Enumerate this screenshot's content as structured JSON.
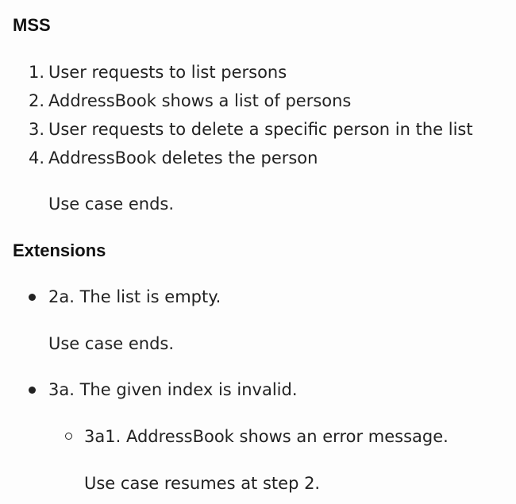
{
  "mss": {
    "heading": "MSS",
    "steps": [
      {
        "marker": "1.",
        "text": "User requests to list persons"
      },
      {
        "marker": "2.",
        "text": "AddressBook shows a list of persons"
      },
      {
        "marker": "3.",
        "text": "User requests to delete a specific person in the list"
      },
      {
        "marker": "4.",
        "text": "AddressBook deletes the person"
      }
    ],
    "conclusion": "Use case ends."
  },
  "extensions": {
    "heading": "Extensions",
    "items": [
      {
        "text": "2a. The list is empty.",
        "note": "Use case ends."
      },
      {
        "text": "3a. The given index is invalid.",
        "subitems": [
          {
            "text": "3a1. AddressBook shows an error message.",
            "note": "Use case resumes at step 2."
          }
        ]
      }
    ]
  }
}
